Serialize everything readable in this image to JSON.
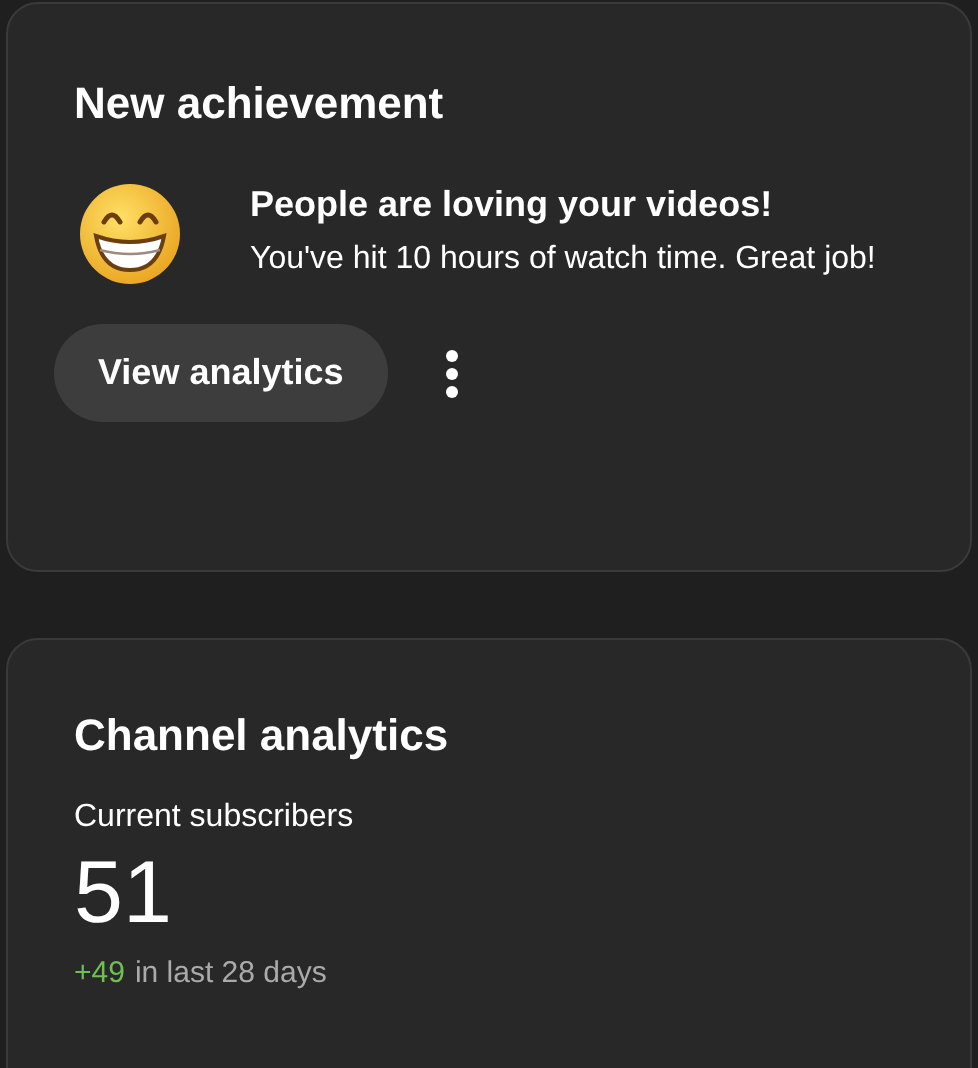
{
  "achievement_card": {
    "title": "New achievement",
    "heading": "People are loving your videos!",
    "message": "You've hit 10 hours of watch time. Great job!",
    "button": "View analytics"
  },
  "analytics_card": {
    "title": "Channel analytics",
    "metric_label": "Current subscribers",
    "metric_value": "51",
    "change": "+49",
    "period": "in last 28 days"
  }
}
